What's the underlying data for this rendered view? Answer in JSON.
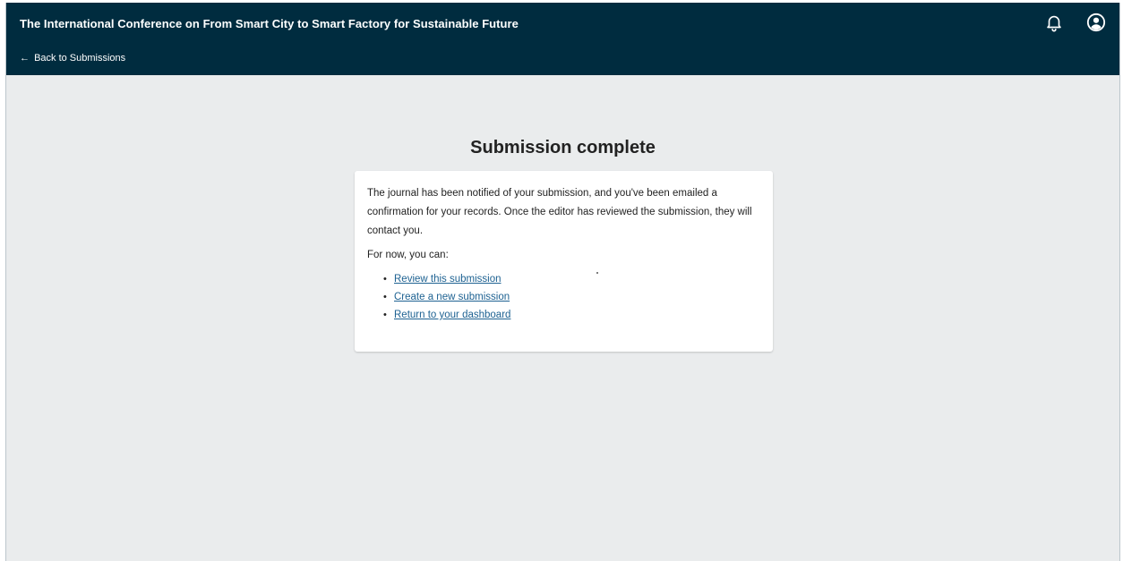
{
  "header": {
    "title": "The International Conference on From Smart City to Smart Factory for Sustainable Future",
    "back_label": "Back to Submissions",
    "back_arrow": "←",
    "icons": {
      "notifications": "bell-icon",
      "user": "user-circle-icon"
    }
  },
  "main": {
    "heading": "Submission complete",
    "message": "The journal has been notified of your submission, and you've been emailed a confirmation for your records. Once the editor has reviewed the submission, they will contact you.",
    "options_intro": "For now, you can:",
    "bullet": "•",
    "links": [
      {
        "label": "Review this submission"
      },
      {
        "label": "Create a new submission"
      },
      {
        "label": "Return to your dashboard"
      }
    ]
  },
  "colors": {
    "header_bg": "#002c3f",
    "page_bg": "#eaeced",
    "link": "#1e6292"
  }
}
